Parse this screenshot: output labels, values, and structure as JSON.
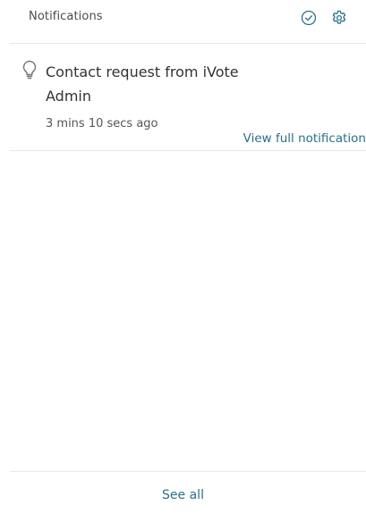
{
  "header": {
    "title": "Notifications",
    "mark_read_icon": "check-circle-icon",
    "settings_icon": "gear-icon"
  },
  "notifications": [
    {
      "icon": "lightbulb-icon",
      "title": "Contact request from iVote Admin",
      "time": "3 mins 10 secs ago",
      "link": "View full notification"
    }
  ],
  "footer": {
    "see_all": "See all"
  },
  "colors": {
    "accent": "#2a6f8a",
    "text": "#333333",
    "muted": "#555555",
    "divider": "#e8e8e8"
  }
}
